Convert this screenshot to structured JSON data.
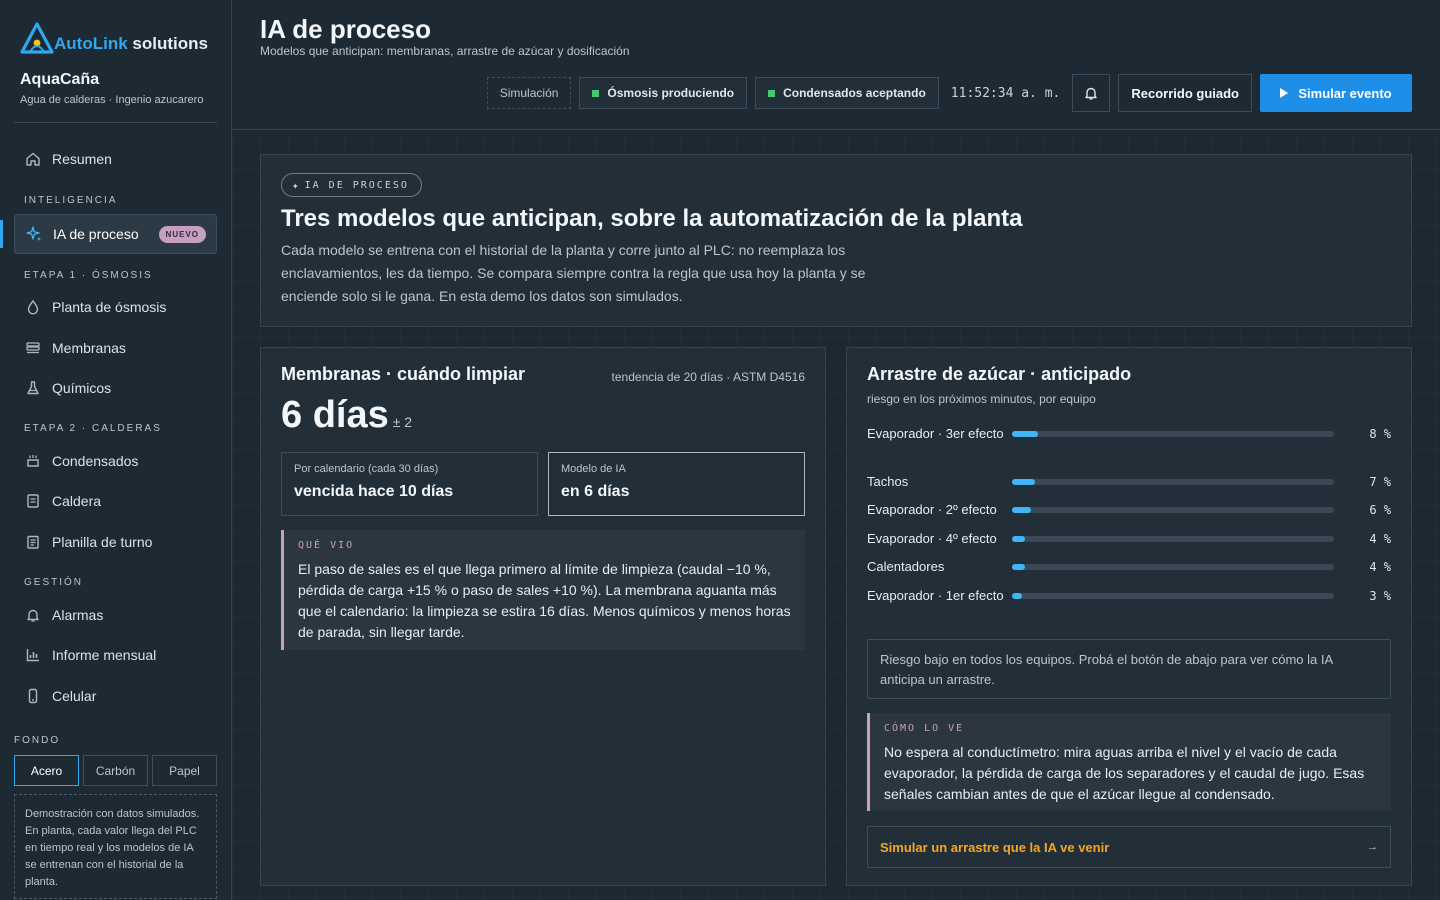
{
  "brand": {
    "logo_auto": "AutoLink",
    "logo_solutions": "solutions",
    "name": "AquaCaña",
    "subtitle": "Agua de calderas · Ingenio azucarero"
  },
  "sidebar": {
    "resumen": "Resumen",
    "sec_inteligencia": "INTELIGENCIA",
    "ia_proceso": "IA de proceso",
    "badge_nuevo": "NUEVO",
    "sec_etapa1": "ETAPA 1 · ÓSMOSIS",
    "planta_osmosis": "Planta de ósmosis",
    "membranas": "Membranas",
    "quimicos": "Químicos",
    "sec_etapa2": "ETAPA 2 · CALDERAS",
    "condensados": "Condensados",
    "caldera": "Caldera",
    "planilla": "Planilla de turno",
    "sec_gestion": "GESTIÓN",
    "alarmas": "Alarmas",
    "informe": "Informe mensual",
    "celular": "Celular",
    "fondo_label": "FONDO",
    "theme_acero": "Acero",
    "theme_carbon": "Carbón",
    "theme_papel": "Papel",
    "demo_note": "Demostración con datos simulados. En planta, cada valor llega del PLC en tiempo real y los modelos de IA se entrenan con el historial de la planta."
  },
  "header": {
    "title": "IA de proceso",
    "subtitle": "Modelos que anticipan: membranas, arrastre de azúcar y dosificación",
    "simulacion": "Simulación",
    "osmosis_status": "Ósmosis produciendo",
    "condensados_status": "Condensados aceptando",
    "clock": "11:52:34 a. m.",
    "tour_button": "Recorrido guiado",
    "simulate_button": "Simular evento",
    "status_color": "#48c774",
    "accent_color": "#1f8ee6"
  },
  "hero": {
    "tag": "IA DE PROCESO",
    "title": "Tres modelos que anticipan, sobre la automatización de la planta",
    "description": "Cada modelo se entrena con el historial de la planta y corre junto al PLC: no reemplaza los enclavamientos, les da tiempo. Se compara siempre contra la regla que usa hoy la planta y se enciende solo si le gana. En esta demo los datos son simulados."
  },
  "membranas": {
    "title": "Membranas · cuándo limpiar",
    "meta": "tendencia de 20 días · ASTM D4516",
    "days": "6 días",
    "plusminus": "± 2",
    "calendar_label": "Por calendario (cada 30 días)",
    "calendar_value": "vencida hace 10 días",
    "ai_label": "Modelo de IA",
    "ai_value": "en 6 días",
    "insight_label": "QUÉ VIO",
    "insight_text": "El paso de sales es el que llega primero al límite de limpieza (caudal −10 %, pérdida de carga +15 % o paso de sales +10 %). La membrana aguanta más que el calendario: la limpieza se estira 16 días. Menos químicos y menos horas de parada, sin llegar tarde."
  },
  "arrastre": {
    "title": "Arrastre de azúcar · anticipado",
    "subtitle": "riesgo en los próximos minutos, por equipo",
    "rows": [
      {
        "name": "Evaporador · 3er efecto",
        "value": 8,
        "label": "8 %"
      },
      {
        "name": "Tachos",
        "value": 7,
        "label": "7 %"
      },
      {
        "name": "Evaporador · 2º efecto",
        "value": 6,
        "label": "6 %"
      },
      {
        "name": "Evaporador · 4º efecto",
        "value": 4,
        "label": "4 %"
      },
      {
        "name": "Calentadores",
        "value": 4,
        "label": "4 %"
      },
      {
        "name": "Evaporador · 1er efecto",
        "value": 3,
        "label": "3 %"
      }
    ],
    "note": "Riesgo bajo en todos los equipos. Probá el botón de abajo para ver cómo la IA anticipa un arrastre.",
    "insight_label": "CÓMO LO VE",
    "insight_text": "No espera al conductímetro: mira aguas arriba el nivel y el vacío de cada evaporador, la pérdida de carga de los separadores y el caudal de jugo. Esas señales cambian antes de que el azúcar llegue al condensado.",
    "sim_link": "Simular un arrastre que la IA ve venir",
    "sim_link_arrow": "→",
    "bar_color": "#3fb6f5",
    "link_color": "#f5a623"
  }
}
